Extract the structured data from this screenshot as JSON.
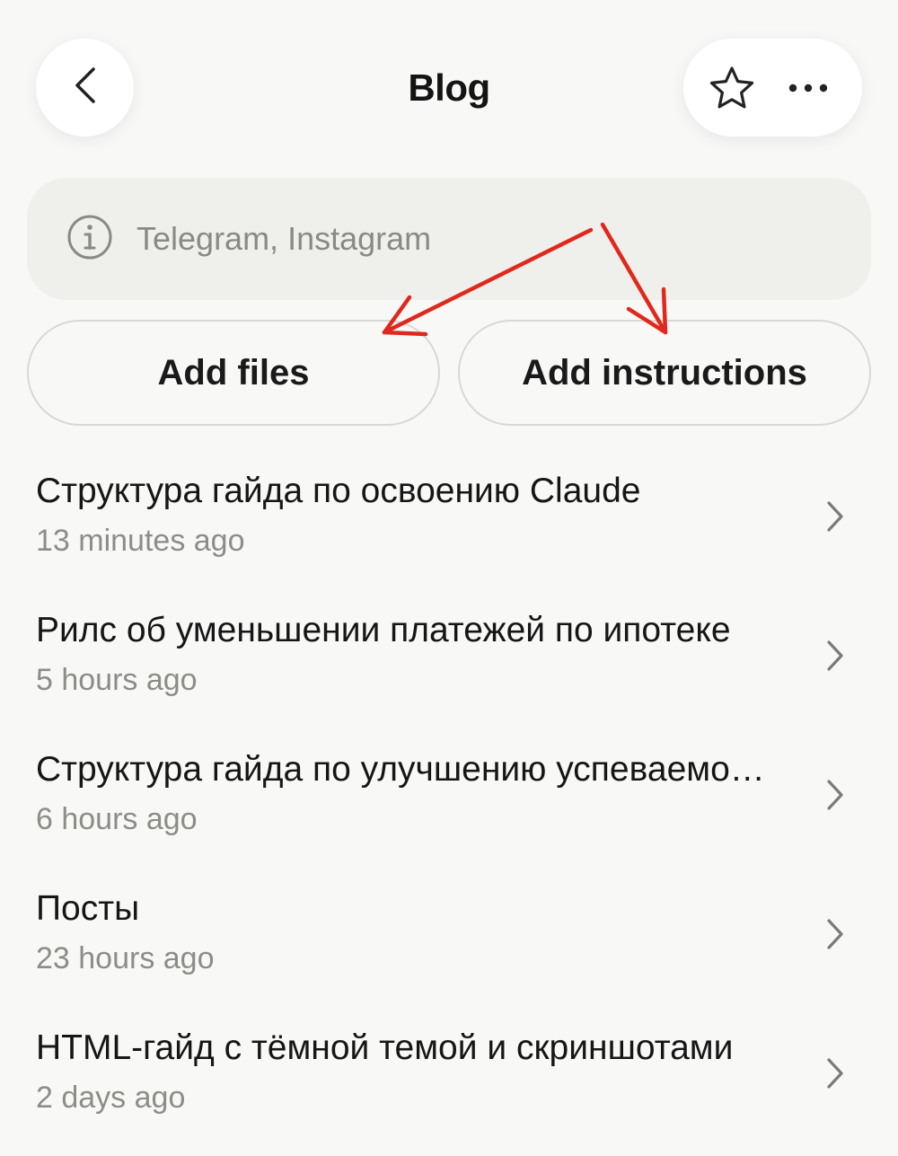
{
  "header": {
    "title": "Blog",
    "back_icon": "chevron-left-icon",
    "star_icon": "star-icon",
    "more_icon": "more-horizontal-icon"
  },
  "description": {
    "icon": "info-icon",
    "text": "Telegram, Instagram"
  },
  "actions": {
    "add_files_label": "Add files",
    "add_instructions_label": "Add instructions"
  },
  "annotation": {
    "color": "#e0281c"
  },
  "chats": [
    {
      "title": "Структура гайда по освоению Claude",
      "time": "13 minutes ago"
    },
    {
      "title": "Рилс об уменьшении платежей по ипотеке",
      "time": "5 hours ago"
    },
    {
      "title": "Структура гайда по улучшению успеваемости",
      "time": "6 hours ago"
    },
    {
      "title": "Посты",
      "time": "23 hours ago"
    },
    {
      "title": "HTML-гайд с тёмной темой и скриншотами",
      "time": "2 days ago"
    }
  ]
}
